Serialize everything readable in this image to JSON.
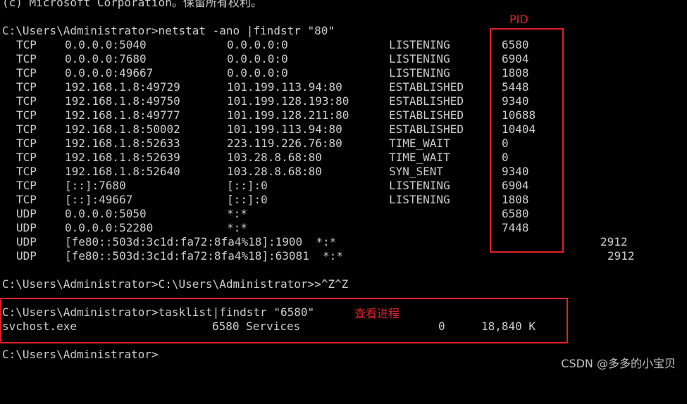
{
  "terminal": {
    "copyright_line": "(c) Microsoft Corporation。保留所有权利。",
    "cmd1": "C:\\Users\\Administrator>netstat -ano |findstr \"80\"",
    "netstat_rows": [
      {
        "proto": "TCP",
        "local": "0.0.0.0:5040",
        "foreign": "0.0.0.0:0",
        "state": "LISTENING",
        "pid": "6580"
      },
      {
        "proto": "TCP",
        "local": "0.0.0.0:7680",
        "foreign": "0.0.0.0:0",
        "state": "LISTENING",
        "pid": "6904"
      },
      {
        "proto": "TCP",
        "local": "0.0.0.0:49667",
        "foreign": "0.0.0.0:0",
        "state": "LISTENING",
        "pid": "1808"
      },
      {
        "proto": "TCP",
        "local": "192.168.1.8:49729",
        "foreign": "101.199.113.94:80",
        "state": "ESTABLISHED",
        "pid": "5448"
      },
      {
        "proto": "TCP",
        "local": "192.168.1.8:49750",
        "foreign": "101.199.128.193:80",
        "state": "ESTABLISHED",
        "pid": "9340"
      },
      {
        "proto": "TCP",
        "local": "192.168.1.8:49777",
        "foreign": "101.199.128.211:80",
        "state": "ESTABLISHED",
        "pid": "10688"
      },
      {
        "proto": "TCP",
        "local": "192.168.1.8:50002",
        "foreign": "101.199.113.94:80",
        "state": "ESTABLISHED",
        "pid": "10404"
      },
      {
        "proto": "TCP",
        "local": "192.168.1.8:52633",
        "foreign": "223.119.226.76:80",
        "state": "TIME_WAIT",
        "pid": "0"
      },
      {
        "proto": "TCP",
        "local": "192.168.1.8:52639",
        "foreign": "103.28.8.68:80",
        "state": "TIME_WAIT",
        "pid": "0"
      },
      {
        "proto": "TCP",
        "local": "192.168.1.8:52640",
        "foreign": "103.28.8.68:80",
        "state": "SYN_SENT",
        "pid": "9340"
      },
      {
        "proto": "TCP",
        "local": "[::]:7680",
        "foreign": "[::]:0",
        "state": "LISTENING",
        "pid": "6904"
      },
      {
        "proto": "TCP",
        "local": "[::]:49667",
        "foreign": "[::]:0",
        "state": "LISTENING",
        "pid": "1808"
      },
      {
        "proto": "UDP",
        "local": "0.0.0.0:5050",
        "foreign": "*:*",
        "state": "",
        "pid": "6580"
      },
      {
        "proto": "UDP",
        "local": "0.0.0.0:52280",
        "foreign": "*:*",
        "state": "",
        "pid": "7448"
      }
    ],
    "udp_v6_rows": [
      {
        "proto": "UDP",
        "local_foreign": "[fe80::503d:3c1d:fa72:8fa4%18]:1900  *:*",
        "pid": "2912"
      },
      {
        "proto": "UDP",
        "local_foreign": "[fe80::503d:3c1d:fa72:8fa4%18]:63081  *:*",
        "pid": "2912"
      }
    ],
    "cmd2": "C:\\Users\\Administrator>C:\\Users\\Administrator>>^Z^Z",
    "cmd3": "C:\\Users\\Administrator>tasklist|findstr \"6580\"",
    "task_row": {
      "image": "svchost.exe",
      "pid_session": "6580 Services",
      "session_num": "0",
      "mem": "18,840 K"
    },
    "prompt": "C:\\Users\\Administrator>"
  },
  "annotations": {
    "pid_label": "PID",
    "process_label": "查看进程",
    "color": "#e0202a"
  },
  "watermark": "CSDN @多多的小宝贝"
}
